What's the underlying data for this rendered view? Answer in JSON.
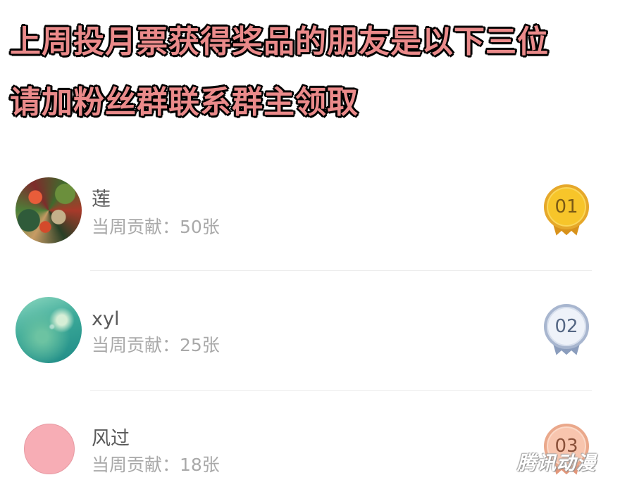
{
  "headline": {
    "line1": "上周投月票获得奖品的朋友是以下三位",
    "line2": "请加粉丝群联系群主领取"
  },
  "ranking": [
    {
      "name": "莲",
      "contribution": "当周贡献：50张",
      "rank": "01",
      "medal": "gold-medal-icon",
      "avatar": "artwork-avatar"
    },
    {
      "name": "xyl",
      "contribution": "当周贡献：25张",
      "rank": "02",
      "medal": "silver-medal-icon",
      "avatar": "teal-dandelion-avatar"
    },
    {
      "name": "风过",
      "contribution": "当周贡献：18张",
      "rank": "03",
      "medal": "bronze-medal-icon",
      "avatar": "pink-circle-avatar"
    }
  ],
  "colors": {
    "headline": "#ea8a8a",
    "gold": "#f7c52a",
    "silver": "#eef2f9",
    "bronze": "#f8c5ae",
    "name_text": "#5a5a5a",
    "contribution_text": "#a9a9a9"
  },
  "watermark": "腾讯动漫"
}
